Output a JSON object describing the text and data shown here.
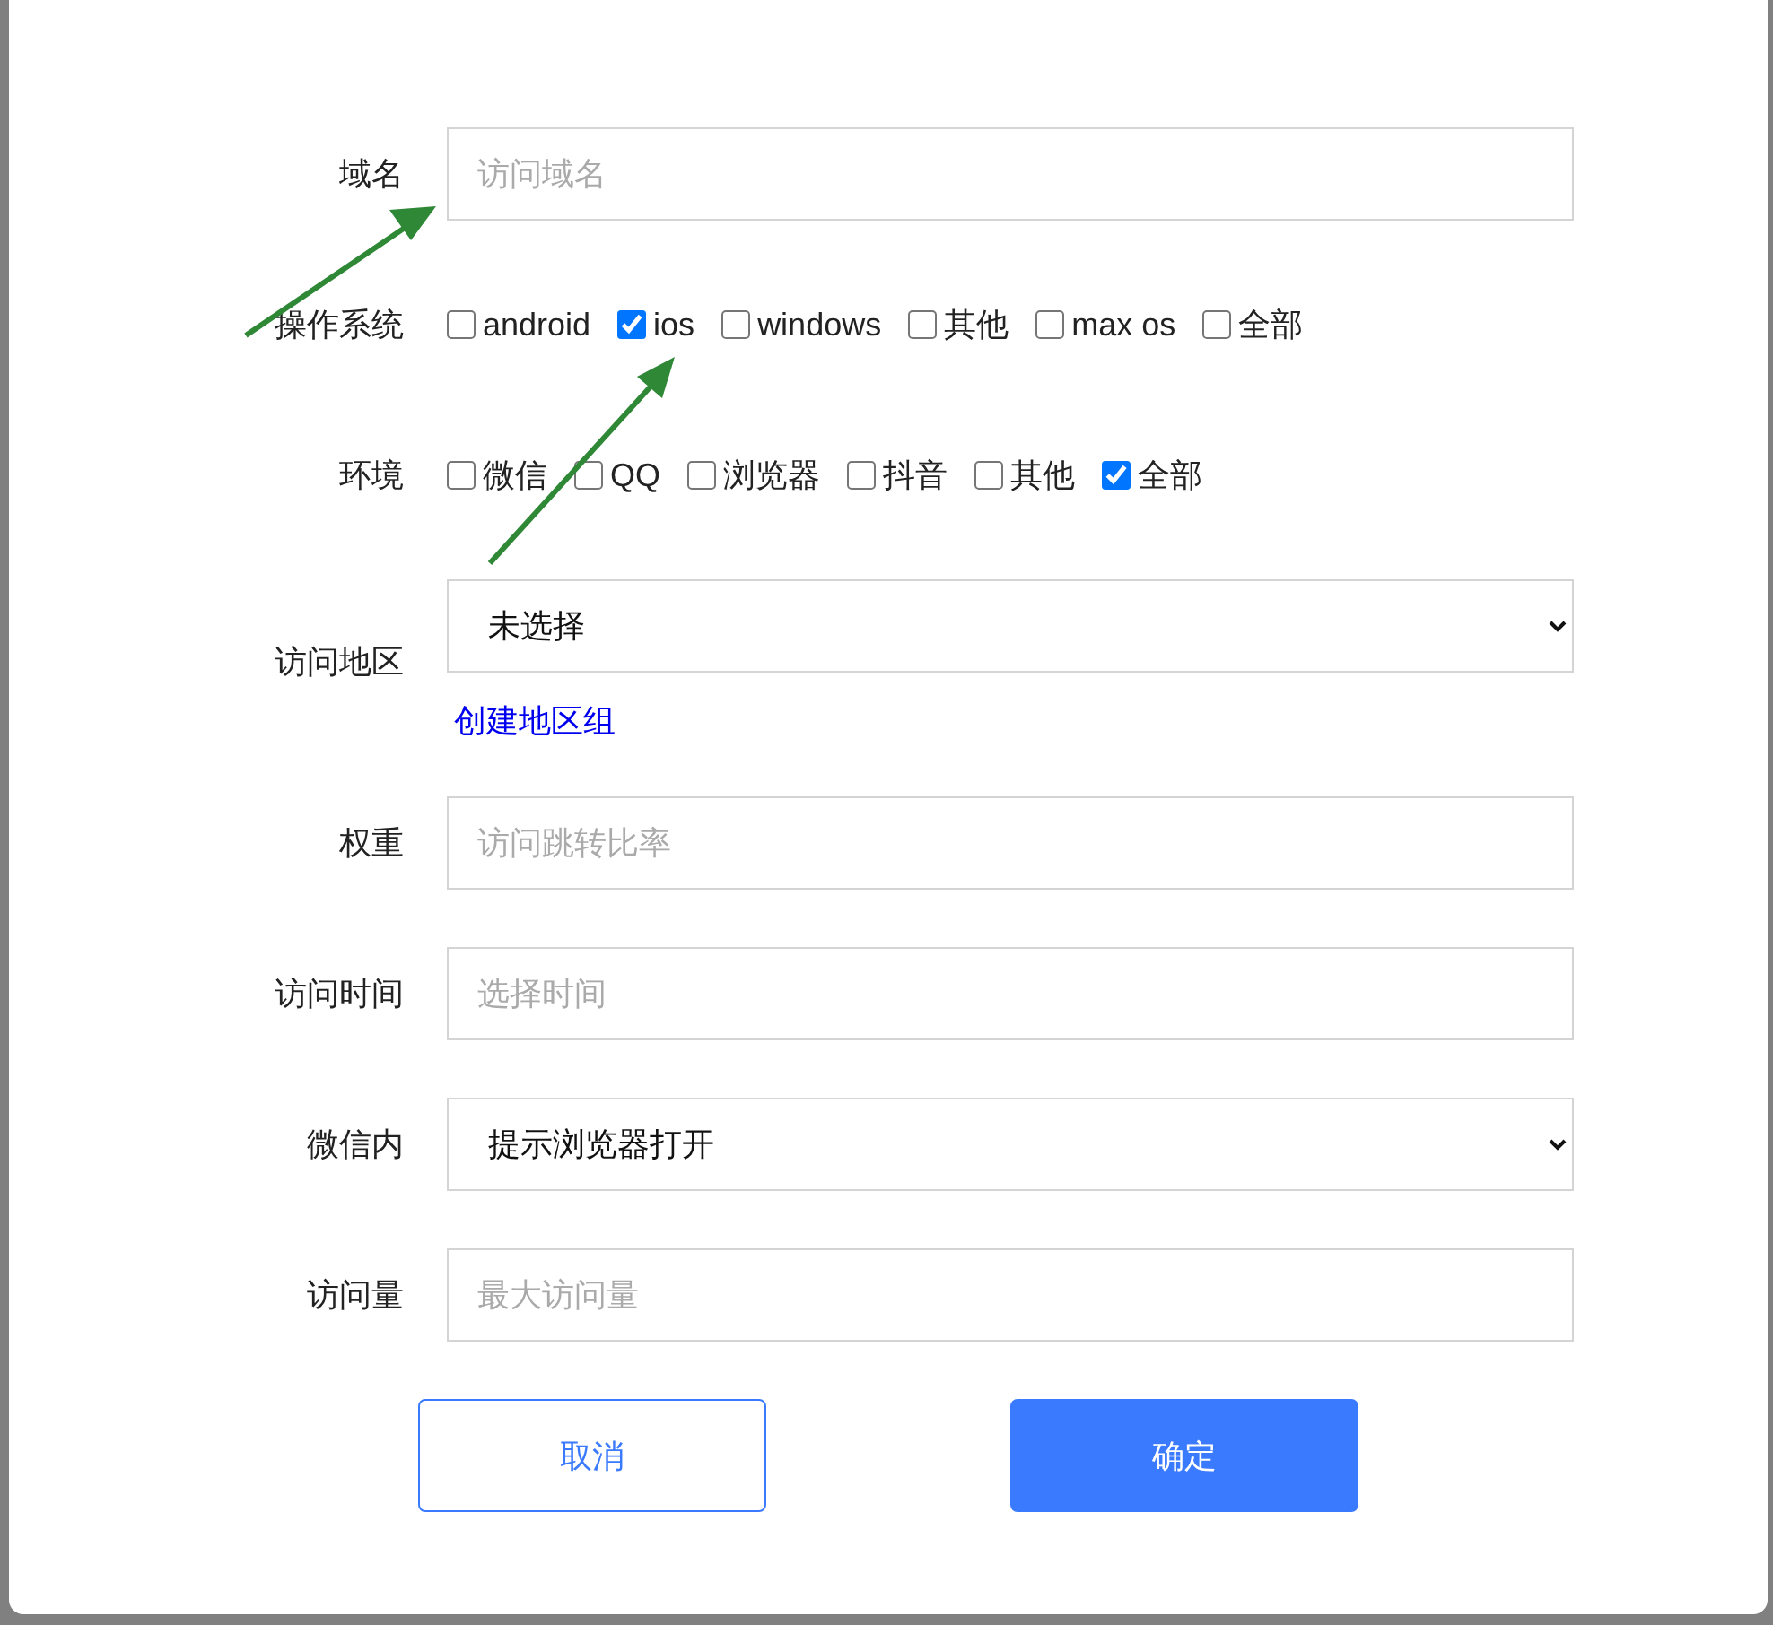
{
  "form": {
    "fields": [
      {
        "kind": "input",
        "label": "域名",
        "placeholder": "访问域名"
      },
      {
        "kind": "checkboxes",
        "label": "操作系统",
        "options": [
          {
            "label": "android",
            "checked": false
          },
          {
            "label": "ios",
            "checked": true
          },
          {
            "label": "windows",
            "checked": false
          },
          {
            "label": "其他",
            "checked": false
          },
          {
            "label": "max os",
            "checked": false
          },
          {
            "label": "全部",
            "checked": false
          }
        ]
      },
      {
        "kind": "checkboxes",
        "label": "环境",
        "options": [
          {
            "label": "微信",
            "checked": false
          },
          {
            "label": "QQ",
            "checked": false
          },
          {
            "label": "浏览器",
            "checked": false
          },
          {
            "label": "抖音",
            "checked": false
          },
          {
            "label": "其他",
            "checked": false
          },
          {
            "label": "全部",
            "checked": true
          }
        ]
      },
      {
        "kind": "select",
        "label": "访问地区",
        "value": "未选择",
        "link": "创建地区组"
      },
      {
        "kind": "input",
        "label": "权重",
        "placeholder": "访问跳转比率"
      },
      {
        "kind": "input",
        "label": "访问时间",
        "placeholder": "选择时间"
      },
      {
        "kind": "select",
        "label": "微信内",
        "value": "提示浏览器打开"
      },
      {
        "kind": "input",
        "label": "访问量",
        "placeholder": "最大访问量"
      }
    ]
  },
  "buttons": [
    {
      "kind": "secondary",
      "label": "取消"
    },
    {
      "kind": "primary",
      "label": "确定"
    }
  ]
}
